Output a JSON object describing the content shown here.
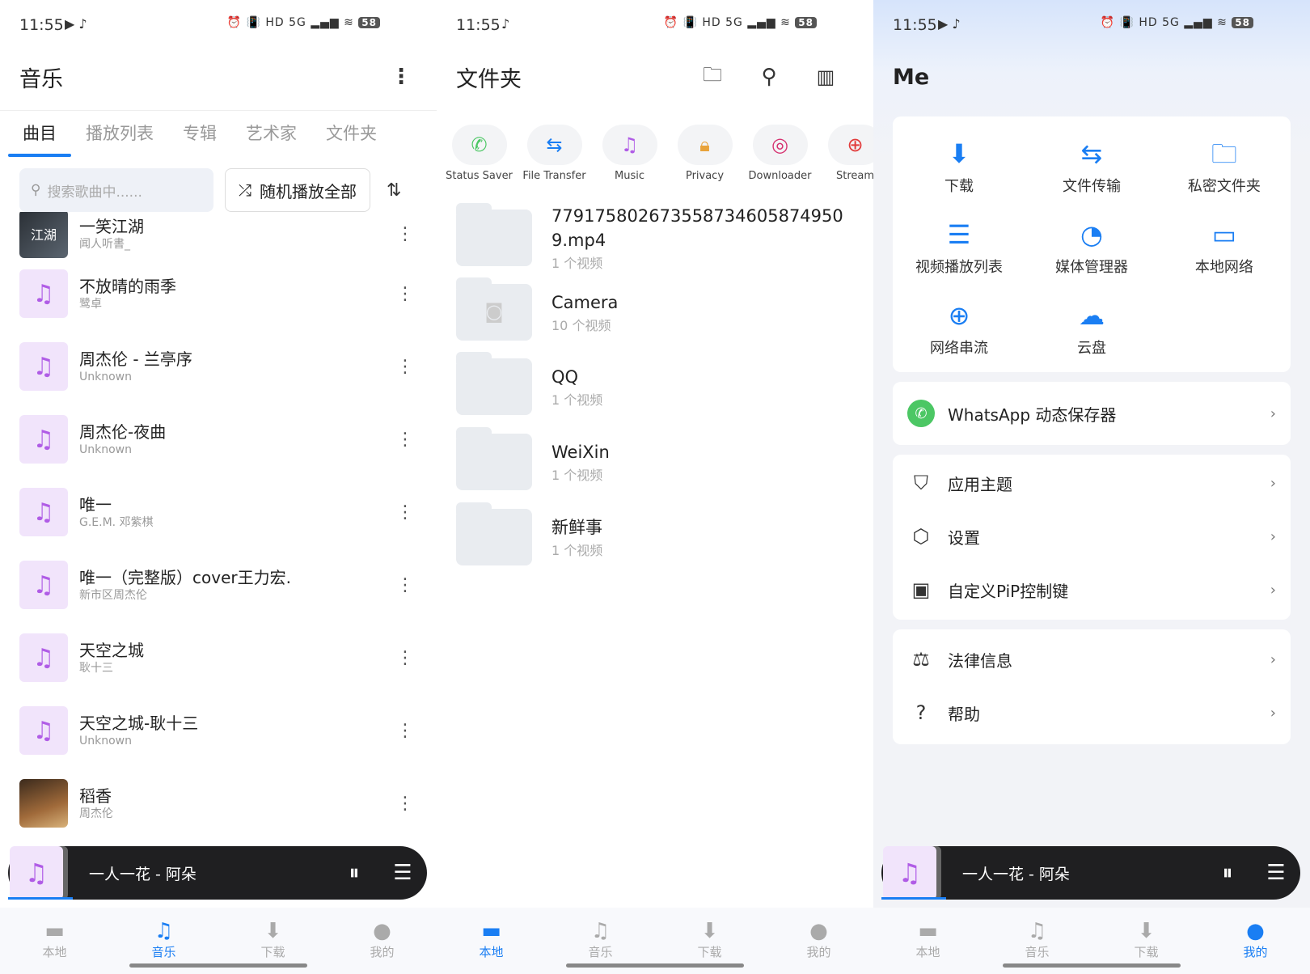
{
  "status": {
    "time": "11:55",
    "battery": "58",
    "left_icons": "▶ ♪",
    "right_icons": "⏰ 📳 HD 5G ▂▄▆ ≋"
  },
  "music": {
    "title": "音乐",
    "tabs": [
      "曲目",
      "播放列表",
      "专辑",
      "艺术家",
      "文件夹"
    ],
    "search_placeholder": "搜索歌曲中......",
    "shuffle_label": "随机播放全部",
    "songs": [
      {
        "name": "一笑江湖",
        "artist": "闻人听書_"
      },
      {
        "name": "不放晴的雨季",
        "artist": "鹭卓"
      },
      {
        "name": "周杰伦 - 兰亭序",
        "artist": "Unknown"
      },
      {
        "name": "周杰伦-夜曲",
        "artist": "Unknown"
      },
      {
        "name": "唯一",
        "artist": "G.E.M. 邓紫棋"
      },
      {
        "name": "唯一（完整版）cover王力宏.",
        "artist": "新市区周杰伦"
      },
      {
        "name": "天空之城",
        "artist": "耿十三"
      },
      {
        "name": "天空之城-耿十三",
        "artist": "Unknown"
      },
      {
        "name": "稻香",
        "artist": "周杰伦"
      }
    ]
  },
  "player": {
    "title": "一人一花 - 阿朵"
  },
  "nav": [
    "本地",
    "音乐",
    "下载",
    "我的"
  ],
  "folders": {
    "title": "文件夹",
    "shortcuts": [
      "Status Saver",
      "File Transfer",
      "Music",
      "Privacy",
      "Downloader",
      "Stream"
    ],
    "items": [
      {
        "name": "779175802673558734605874950​9.mp4",
        "count": "1 个视频"
      },
      {
        "name": "Camera",
        "count": "10 个视频"
      },
      {
        "name": "QQ",
        "count": "1 个视频"
      },
      {
        "name": "WeiXin",
        "count": "1 个视频"
      },
      {
        "name": "新鲜事",
        "count": "1 个视频"
      }
    ]
  },
  "me": {
    "title": "Me",
    "grid": [
      "下载",
      "文件传输",
      "私密文件夹",
      "视频播放列表",
      "媒体管理器",
      "本地网络",
      "网络串流",
      "云盘"
    ],
    "whatsapp": "WhatsApp 动态保存器",
    "settings": [
      "应用主题",
      "设置",
      "自定义PiP控制键"
    ],
    "info": [
      "法律信息",
      "帮助"
    ]
  },
  "colors": {
    "accent": "#1a7ef3",
    "music_purple": "#b05ce6",
    "whatsapp_green": "#4cc764"
  }
}
